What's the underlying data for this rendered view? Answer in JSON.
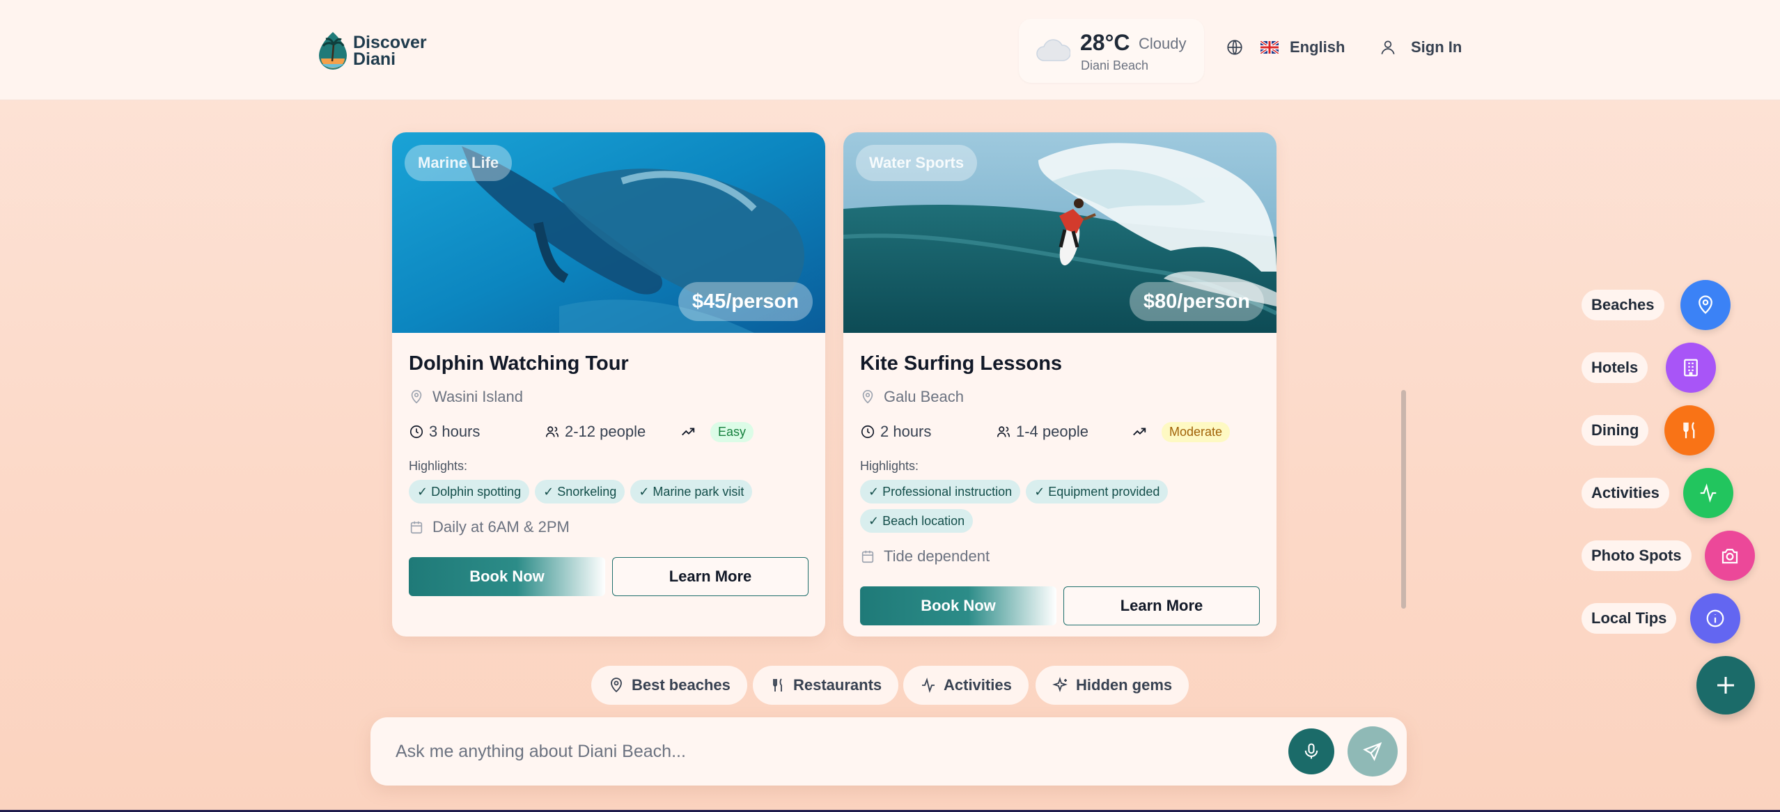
{
  "header": {
    "logo": {
      "line1": "Discover",
      "line2": "Diani"
    },
    "weather": {
      "temperature": "28°C",
      "condition": "Cloudy",
      "location": "Diani Beach",
      "icon": "cloud-icon"
    },
    "language": {
      "label": "English",
      "icon": "globe-icon",
      "flag": "uk-flag-icon"
    },
    "sign_in": {
      "label": "Sign In",
      "icon": "user-icon"
    }
  },
  "cards": [
    {
      "category": "Marine Life",
      "price": "$45/person",
      "title": "Dolphin Watching Tour",
      "location": "Wasini Island",
      "duration": "3 hours",
      "group": "2-12 people",
      "difficulty": "Easy",
      "highlights_label": "Highlights:",
      "highlights": [
        "✓ Dolphin spotting",
        "✓ Snorkeling",
        "✓ Marine park visit"
      ],
      "schedule": "Daily at 6AM & 2PM",
      "book_label": "Book Now",
      "learn_label": "Learn More"
    },
    {
      "category": "Water Sports",
      "price": "$80/person",
      "title": "Kite Surfing Lessons",
      "location": "Galu Beach",
      "duration": "2 hours",
      "group": "1-4 people",
      "difficulty": "Moderate",
      "highlights_label": "Highlights:",
      "highlights": [
        "✓ Professional instruction",
        "✓ Equipment provided",
        "✓ Beach location"
      ],
      "schedule": "Tide dependent",
      "book_label": "Book Now",
      "learn_label": "Learn More"
    }
  ],
  "quick_actions": [
    {
      "label": "Best beaches",
      "icon": "map-pin-icon"
    },
    {
      "label": "Restaurants",
      "icon": "utensils-icon"
    },
    {
      "label": "Activities",
      "icon": "activity-icon"
    },
    {
      "label": "Hidden gems",
      "icon": "sparkles-icon"
    }
  ],
  "chat": {
    "placeholder": "Ask me anything about Diani Beach...",
    "mic_icon": "microphone-icon",
    "send_icon": "send-icon"
  },
  "fab_menu": [
    {
      "label": "Beaches",
      "icon": "map-pin-icon",
      "color": "#3b82f6"
    },
    {
      "label": "Hotels",
      "icon": "building-icon",
      "color": "#a855f7"
    },
    {
      "label": "Dining",
      "icon": "utensils-icon",
      "color": "#f97316"
    },
    {
      "label": "Activities",
      "icon": "activity-icon",
      "color": "#22c55e"
    },
    {
      "label": "Photo Spots",
      "icon": "camera-icon",
      "color": "#ec4899"
    },
    {
      "label": "Local Tips",
      "icon": "info-icon",
      "color": "#6366f1"
    }
  ],
  "fab_main_icon": "plus-icon",
  "colors": {
    "primary": "#1b6b69",
    "chip_bg": "#d9eeee"
  }
}
